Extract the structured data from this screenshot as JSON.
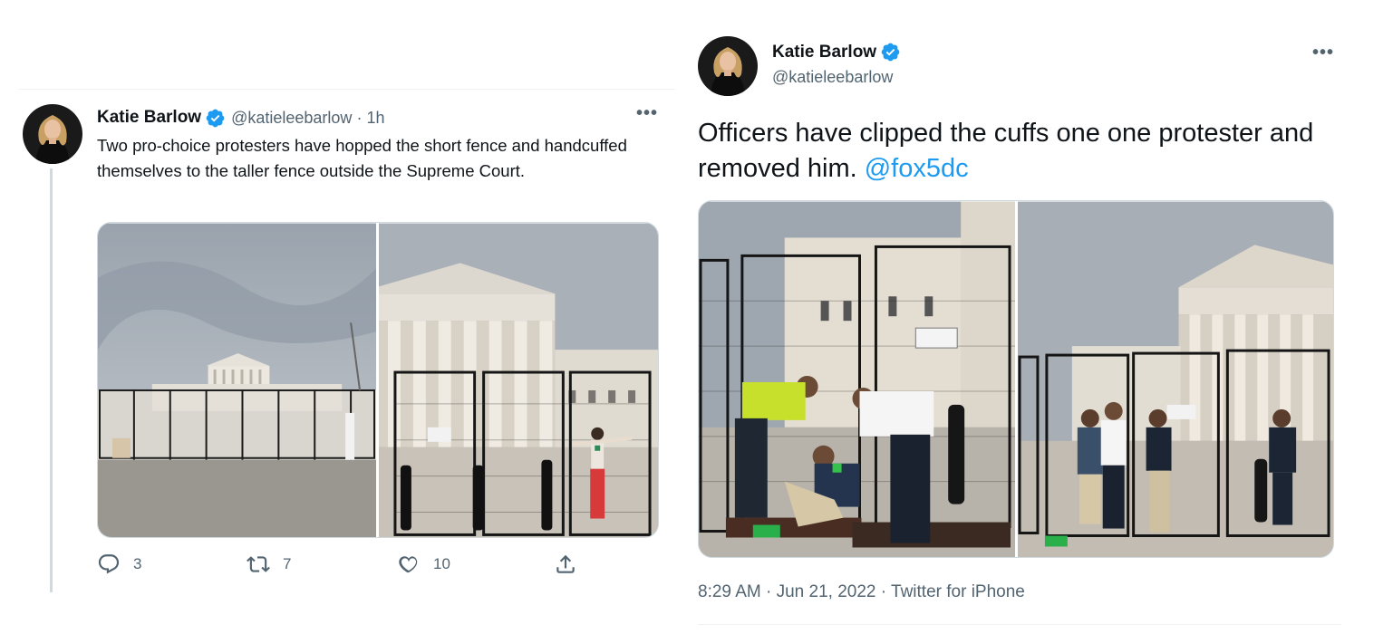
{
  "left_tweet": {
    "author_name": "Katie Barlow",
    "handle": "@katieleebarlow",
    "separator": "·",
    "time": "1h",
    "more": "•••",
    "text": "Two pro-choice protesters have hopped the short fence and handcuffed themselves to the taller fence outside the Supreme Court.",
    "photos": [
      "supreme-court-wide-photo",
      "protester-at-fence-photo"
    ],
    "actions": {
      "replies": "3",
      "retweets": "7",
      "likes": "10"
    }
  },
  "right_tweet": {
    "author_name": "Katie Barlow",
    "handle": "@katieleebarlow",
    "more": "•••",
    "text": "Officers have clipped the cuffs one one protester and removed him. ",
    "mention": "@fox5dc",
    "photos": [
      "officers-removing-protester-photo",
      "protester-escorted-photo"
    ],
    "meta": "8:29 AM · Jun 21, 2022 · Twitter for iPhone"
  },
  "colors": {
    "text_primary": "#0f1419",
    "text_secondary": "#536471",
    "accent": "#1d9bf0",
    "border": "#cfd9de"
  },
  "icons": [
    "verified-badge-icon",
    "reply-icon",
    "retweet-icon",
    "like-icon",
    "share-icon",
    "more-icon"
  ]
}
